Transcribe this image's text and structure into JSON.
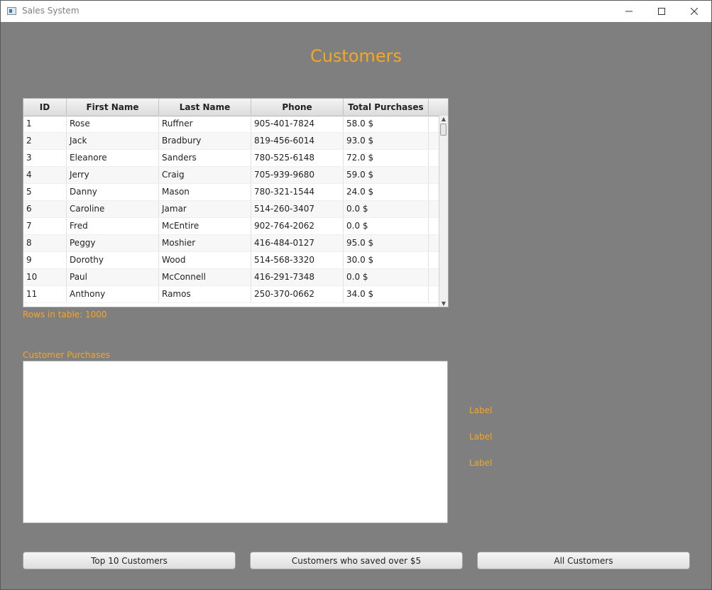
{
  "window": {
    "title": "Sales System"
  },
  "heading": "Customers",
  "table": {
    "columns": [
      "ID",
      "First Name",
      "Last Name",
      "Phone",
      "Total Purchases"
    ],
    "rows": [
      [
        "1",
        "Rose",
        "Ruffner",
        "905-401-7824",
        "58.0 $"
      ],
      [
        "2",
        "Jack",
        "Bradbury",
        "819-456-6014",
        "93.0 $"
      ],
      [
        "3",
        "Eleanore",
        "Sanders",
        "780-525-6148",
        "72.0 $"
      ],
      [
        "4",
        "Jerry",
        "Craig",
        "705-939-9680",
        "59.0 $"
      ],
      [
        "5",
        "Danny",
        "Mason",
        "780-321-1544",
        "24.0 $"
      ],
      [
        "6",
        "Caroline",
        "Jamar",
        "514-260-3407",
        "0.0 $"
      ],
      [
        "7",
        "Fred",
        "McEntire",
        "902-764-2062",
        "0.0 $"
      ],
      [
        "8",
        "Peggy",
        "Moshier",
        "416-484-0127",
        "95.0 $"
      ],
      [
        "9",
        "Dorothy",
        "Wood",
        "514-568-3320",
        "30.0 $"
      ],
      [
        "10",
        "Paul",
        "McConnell",
        "416-291-7348",
        "0.0 $"
      ],
      [
        "11",
        "Anthony",
        "Ramos",
        "250-370-0662",
        "34.0 $"
      ]
    ]
  },
  "rows_count_text": "Rows in table: 1000",
  "purchases": {
    "label": "Customer Purchases"
  },
  "side_labels": [
    "Label",
    "Label",
    "Label"
  ],
  "buttons": {
    "top10": "Top 10 Customers",
    "saved": "Customers who saved over $5",
    "all": "All Customers"
  },
  "colors": {
    "accent": "#f5a623",
    "background": "#7f7f7f"
  },
  "icons": {
    "minimize": "minimize-icon",
    "maximize": "maximize-icon",
    "close": "close-icon"
  }
}
